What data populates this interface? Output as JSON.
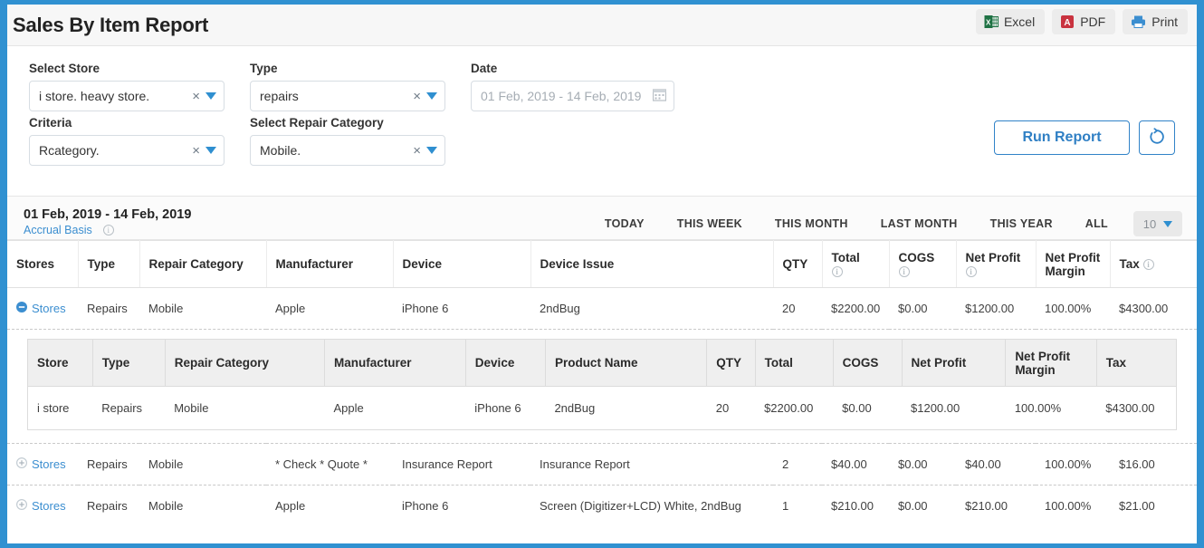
{
  "header": {
    "title": "Sales By Item Report",
    "actions": [
      {
        "label": "Excel",
        "icon": "excel-icon"
      },
      {
        "label": "PDF",
        "icon": "pdf-icon"
      },
      {
        "label": "Print",
        "icon": "printer-icon"
      }
    ]
  },
  "filters": {
    "select_store": {
      "label": "Select Store",
      "value": "i store. heavy store.",
      "clear": "×"
    },
    "type": {
      "label": "Type",
      "value": "repairs",
      "clear": "×"
    },
    "date": {
      "label": "Date",
      "placeholder": "01 Feb, 2019 - 14 Feb, 2019",
      "value": "",
      "icon": "calendar-icon"
    },
    "criteria": {
      "label": "Criteria",
      "value": "Rcategory.",
      "clear": "×"
    },
    "repair_category": {
      "label": "Select Repair Category",
      "value": "Mobile.",
      "clear": "×"
    },
    "run_report_label": "Run Report",
    "refresh_icon": "refresh-icon"
  },
  "report": {
    "date_range": "01 Feb, 2019 - 14 Feb, 2019",
    "basis": "Accrual Basis",
    "range_tabs": [
      "TODAY",
      "THIS WEEK",
      "THIS MONTH",
      "LAST MONTH",
      "THIS YEAR",
      "ALL"
    ],
    "page_size": "10",
    "main_columns": [
      "Stores",
      "Type",
      "Repair Category",
      "Manufacturer",
      "Device",
      "Device Issue",
      "QTY",
      "Total",
      "COGS",
      "Net Profit",
      "Net Profit Margin",
      "Tax"
    ],
    "main_columns_info": [
      false,
      false,
      false,
      false,
      false,
      false,
      false,
      true,
      true,
      true,
      false,
      true
    ],
    "rows": [
      {
        "expanded": true,
        "toggle_icon": "minus-circle-icon",
        "stores": "Stores",
        "type": "Repairs",
        "repair_category": "Mobile",
        "manufacturer": "Apple",
        "device": "iPhone 6",
        "device_issue": "2ndBug",
        "qty": "20",
        "total": "$2200.00",
        "cogs": "$0.00",
        "net_profit": "$1200.00",
        "net_profit_margin": "100.00%",
        "tax": "$4300.00"
      },
      {
        "expanded": false,
        "toggle_icon": "plus-circle-icon",
        "stores": "Stores",
        "type": "Repairs",
        "repair_category": "Mobile",
        "manufacturer": "* Check * Quote *",
        "device": "Insurance Report",
        "device_issue": "Insurance Report",
        "qty": "2",
        "total": "$40.00",
        "cogs": "$0.00",
        "net_profit": "$40.00",
        "net_profit_margin": "100.00%",
        "tax": "$16.00"
      },
      {
        "expanded": false,
        "toggle_icon": "plus-circle-icon",
        "stores": "Stores",
        "type": "Repairs",
        "repair_category": "Mobile",
        "manufacturer": "Apple",
        "device": "iPhone 6",
        "device_issue": "Screen (Digitizer+LCD) White, 2ndBug",
        "qty": "1",
        "total": "$210.00",
        "cogs": "$0.00",
        "net_profit": "$210.00",
        "net_profit_margin": "100.00%",
        "tax": "$21.00"
      }
    ],
    "nested": {
      "columns": [
        "Store",
        "Type",
        "Repair Category",
        "Manufacturer",
        "Device",
        "Product Name",
        "QTY",
        "Total",
        "COGS",
        "Net Profit",
        "Net Profit Margin",
        "Tax"
      ],
      "rows": [
        {
          "store": "i store",
          "type": "Repairs",
          "repair_category": "Mobile",
          "manufacturer": "Apple",
          "device": "iPhone 6",
          "product_name": "2ndBug",
          "qty": "20",
          "total": "$2200.00",
          "cogs": "$0.00",
          "net_profit": "$1200.00",
          "net_profit_margin": "100.00%",
          "tax": "$4300.00"
        }
      ]
    }
  },
  "colors": {
    "accent_blue": "#3091d1",
    "link_blue": "#3b8ed0",
    "button_border": "#3183c8",
    "excel_green": "#1f7244",
    "pdf_red": "#c9333f"
  }
}
